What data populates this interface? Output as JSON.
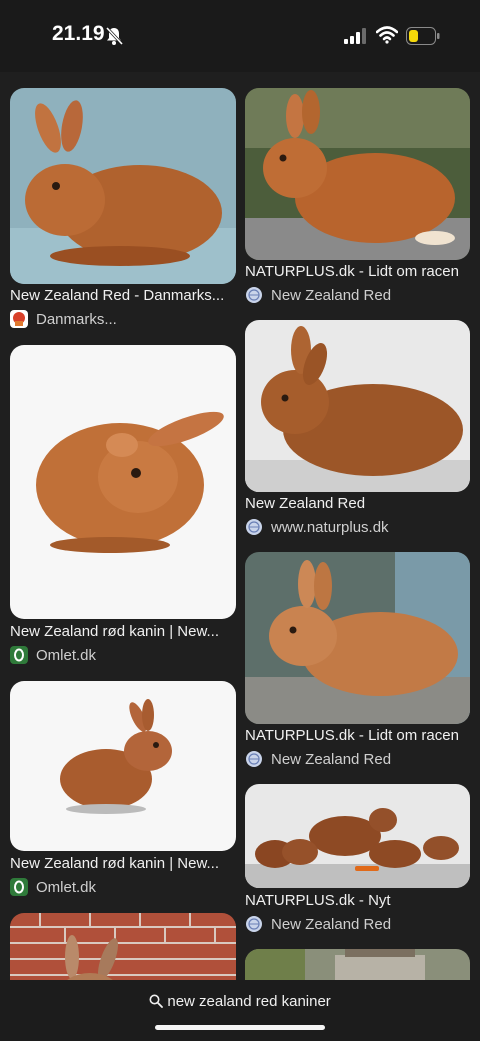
{
  "status": {
    "time": "21.19",
    "icons": [
      "bell-slash-icon",
      "cellular-signal-icon",
      "wifi-icon",
      "battery-icon"
    ],
    "battery_color": "#f5d90a"
  },
  "results": [
    {
      "title": "New Zealand Red - Danmarks...",
      "source": "Danmarks...",
      "icon": "danmarks-favicon-icon"
    },
    {
      "title": "NATURPLUS.dk - Lidt om racen",
      "source": "New Zealand Red",
      "icon": "globe-icon"
    },
    {
      "title": "New Zealand Red",
      "source": "www.naturplus.dk",
      "icon": "globe-icon"
    },
    {
      "title": "New Zealand rød kanin | New...",
      "source": "Omlet.dk",
      "icon": "omlet-favicon-icon"
    },
    {
      "title": "NATURPLUS.dk - Lidt om racen",
      "source": "New Zealand Red",
      "icon": "globe-icon"
    },
    {
      "title": "New Zealand rød kanin | New...",
      "source": "Omlet.dk",
      "icon": "omlet-favicon-icon"
    },
    {
      "title": "NATURPLUS.dk - Nyt",
      "source": "New Zealand Red",
      "icon": "globe-icon"
    }
  ],
  "search": {
    "query": "new zealand red kaniner",
    "icon": "search-icon"
  }
}
